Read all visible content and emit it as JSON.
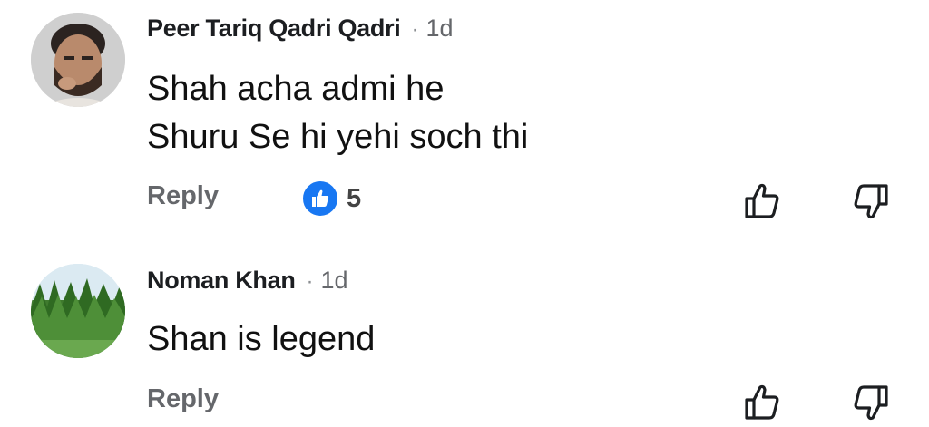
{
  "comments": [
    {
      "author": "Peer Tariq Qadri Qadri",
      "separator": "·",
      "time": "1d",
      "lines": [
        "Shah acha admi he",
        "Shuru Se hi yehi soch thi"
      ],
      "reply_label": "Reply",
      "reaction_icon": "like-icon",
      "reaction_count": "5"
    },
    {
      "author": "Noman Khan",
      "separator": "·",
      "time": "1d",
      "lines": [
        "Shan is legend"
      ],
      "reply_label": "Reply"
    }
  ],
  "colors": {
    "like_blue": "#1877f2",
    "secondary_text": "#65676b"
  }
}
